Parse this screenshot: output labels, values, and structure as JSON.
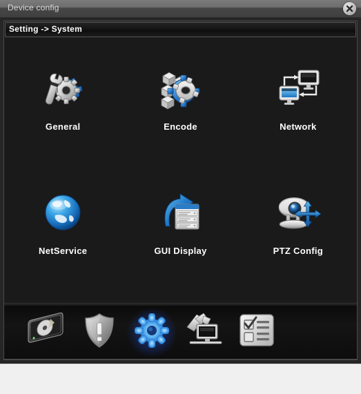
{
  "window": {
    "title": "Device config",
    "close_icon": "close-icon"
  },
  "breadcrumb": {
    "text": "Setting -> System"
  },
  "main": {
    "items": [
      {
        "label": "General",
        "icon": "wrench-gear-icon"
      },
      {
        "label": "Encode",
        "icon": "blocks-gear-icon"
      },
      {
        "label": "Network",
        "icon": "two-monitors-icon"
      },
      {
        "label": "NetService",
        "icon": "globe-icon"
      },
      {
        "label": "GUI Display",
        "icon": "arrow-list-icon"
      },
      {
        "label": "PTZ Config",
        "icon": "dome-camera-arrows-icon"
      }
    ]
  },
  "toolbar": {
    "items": [
      {
        "name": "record-storage",
        "icon": "hard-disk-icon",
        "active": false
      },
      {
        "name": "alarm",
        "icon": "shield-alert-icon",
        "active": false
      },
      {
        "name": "system",
        "icon": "gear-icon",
        "active": true
      },
      {
        "name": "advanced",
        "icon": "computer-tools-icon",
        "active": false
      },
      {
        "name": "info",
        "icon": "checklist-icon",
        "active": false
      }
    ]
  },
  "colors": {
    "accent": "#2f8fe0",
    "active_glow": "#3a7bff",
    "window_bg": "#1a1a1a",
    "titlebar": "#6d6d6d",
    "label_text": "#ffffff"
  }
}
